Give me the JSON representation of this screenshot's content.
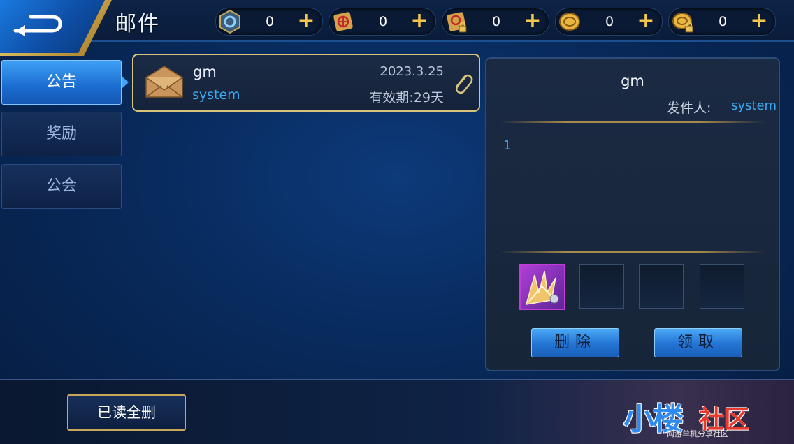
{
  "header": {
    "title": "邮件",
    "currencies": [
      {
        "icon": "rune-token-icon",
        "amount": "0"
      },
      {
        "icon": "red-scroll-icon",
        "amount": "0"
      },
      {
        "icon": "locked-red-scroll-icon",
        "amount": "0"
      },
      {
        "icon": "gold-coin-icon",
        "amount": "0"
      },
      {
        "icon": "locked-gold-coin-icon",
        "amount": "0"
      }
    ],
    "plus_label": "+"
  },
  "tabs": [
    {
      "label": "公告",
      "active": true
    },
    {
      "label": "奖励",
      "active": false
    },
    {
      "label": "公会",
      "active": false
    }
  ],
  "mails": [
    {
      "sender": "gm",
      "type": "system",
      "date": "2023.3.25",
      "expiry": "有效期:29天",
      "has_attachment": true
    }
  ],
  "detail": {
    "title": "gm",
    "from_label": "发件人:",
    "from": "system",
    "body": "1",
    "attachments": [
      "golden-wing-item-icon",
      "",
      "",
      ""
    ],
    "delete_label": "删除",
    "claim_label": "领取"
  },
  "footer": {
    "delete_read_label": "已读全删"
  },
  "watermark": {
    "text1": "小楼",
    "text2": "社区",
    "sub": "网游单机分享社区"
  },
  "colors": {
    "accent_blue": "#3aa9f2",
    "gold": "#d8c37c",
    "plus_gold": "#f4c64b"
  }
}
